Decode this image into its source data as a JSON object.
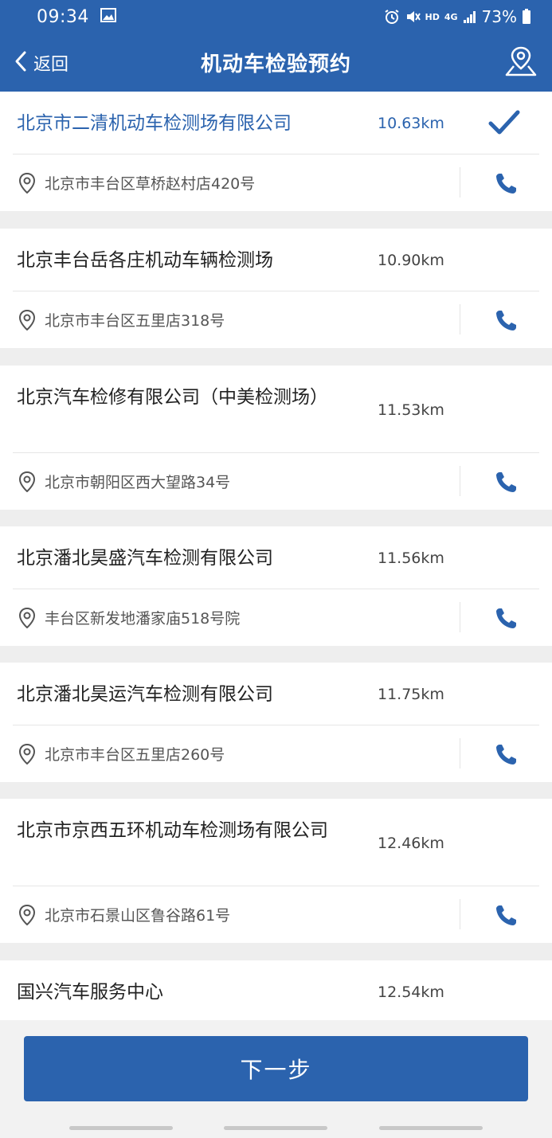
{
  "status_bar": {
    "time": "09:34",
    "network": "HD",
    "signal": "4G",
    "battery": "73%"
  },
  "header": {
    "back_label": "返回",
    "title": "机动车检验预约",
    "accent_color": "#2b63ae"
  },
  "stations": [
    {
      "name": "北京市二清机动车检测场有限公司",
      "distance": "10.63km",
      "address": "北京市丰台区草桥赵村店420号",
      "selected": true
    },
    {
      "name": "北京丰台岳各庄机动车辆检测场",
      "distance": "10.90km",
      "address": "北京市丰台区五里店318号",
      "selected": false
    },
    {
      "name": "北京汽车检修有限公司（中美检测场）",
      "distance": "11.53km",
      "address": "北京市朝阳区西大望路34号",
      "selected": false
    },
    {
      "name": "北京潘北昊盛汽车检测有限公司",
      "distance": "11.56km",
      "address": "丰台区新发地潘家庙518号院",
      "selected": false
    },
    {
      "name": "北京潘北昊运汽车检测有限公司",
      "distance": "11.75km",
      "address": "北京市丰台区五里店260号",
      "selected": false
    },
    {
      "name": "北京市京西五环机动车检测场有限公司",
      "distance": "12.46km",
      "address": "北京市石景山区鲁谷路61号",
      "selected": false
    },
    {
      "name": "国兴汽车服务中心",
      "distance": "12.54km",
      "address": "",
      "selected": false
    }
  ],
  "footer": {
    "next_label": "下一步"
  },
  "icons": {
    "back": "chevron-left-icon",
    "map": "map-pin-icon",
    "selected": "check-icon",
    "address": "location-pin-icon",
    "phone": "phone-icon"
  }
}
